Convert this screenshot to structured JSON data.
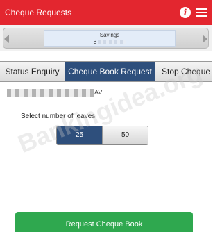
{
  "header": {
    "title": "Cheque Requests",
    "info_icon": "info-icon",
    "menu_icon": "hamburger-menu-icon",
    "background_color": "#e3262f"
  },
  "account": {
    "type": "Savings",
    "number_prefix": "8"
  },
  "tabs": [
    {
      "label": "Status Enquiry",
      "active": false
    },
    {
      "label": "Cheque Book Request",
      "active": true
    },
    {
      "label": "Stop Cheque",
      "active": false
    }
  ],
  "form": {
    "holder_name_suffix": "AV",
    "select_label": "Select number of leaves",
    "leaf_options": [
      "25",
      "50"
    ],
    "selected_leaf": "25"
  },
  "watermark": "Bankingidea.org",
  "actions": {
    "request_label": "Request Cheque Book",
    "request_color": "#2fa84f"
  },
  "colors": {
    "accent": "#2e4f7c"
  }
}
